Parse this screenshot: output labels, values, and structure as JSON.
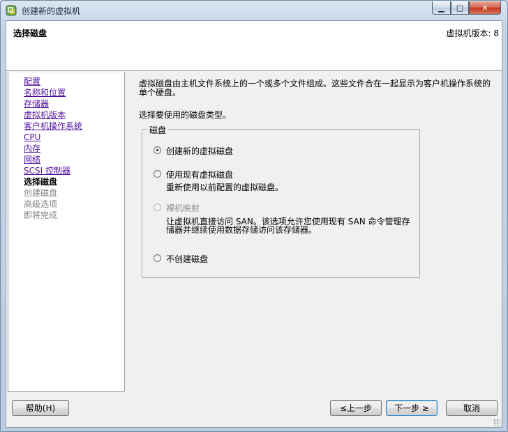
{
  "window": {
    "title": "创建新的虚拟机",
    "controls": {
      "minimize": "▁",
      "maximize": "□",
      "close": "✕"
    }
  },
  "header": {
    "title": "选择磁盘",
    "version": "虚拟机版本: 8"
  },
  "nav": {
    "items": [
      {
        "label": "配置",
        "state": "link"
      },
      {
        "label": "名称和位置",
        "state": "link"
      },
      {
        "label": "存储器",
        "state": "link"
      },
      {
        "label": "虚拟机版本",
        "state": "link"
      },
      {
        "label": "客户机操作系统",
        "state": "link"
      },
      {
        "label": "CPU",
        "state": "link"
      },
      {
        "label": "内存",
        "state": "link"
      },
      {
        "label": "网络",
        "state": "link"
      },
      {
        "label": "SCSI 控制器",
        "state": "link"
      },
      {
        "label": "选择磁盘",
        "state": "current"
      },
      {
        "label": "创建磁盘",
        "state": "pending"
      },
      {
        "label": "高级选项",
        "state": "pending"
      },
      {
        "label": "即将完成",
        "state": "pending"
      }
    ]
  },
  "content": {
    "intro": "虚拟磁盘由主机文件系统上的一个或多个文件组成。这些文件合在一起显示为客户机操作系统的单个硬盘。",
    "prompt": "选择要使用的磁盘类型。",
    "group_label": "磁盘",
    "options": [
      {
        "label": "创建新的虚拟磁盘",
        "description": "",
        "checked": true,
        "disabled": false
      },
      {
        "label": "使用现有虚拟磁盘",
        "description": "重新使用以前配置的虚拟磁盘。",
        "checked": false,
        "disabled": false
      },
      {
        "label": "裸机映射",
        "description": "让虚拟机直接访问 SAN。该选项允许您使用现有 SAN 命令管理存储器并继续使用数据存储访问该存储器。",
        "checked": false,
        "disabled": true
      },
      {
        "label": "不创建磁盘",
        "description": "",
        "checked": false,
        "disabled": false
      }
    ]
  },
  "footer": {
    "help": "帮助(H)",
    "back": "≤上一步",
    "next": "下一步 ≥",
    "cancel": "取消"
  }
}
